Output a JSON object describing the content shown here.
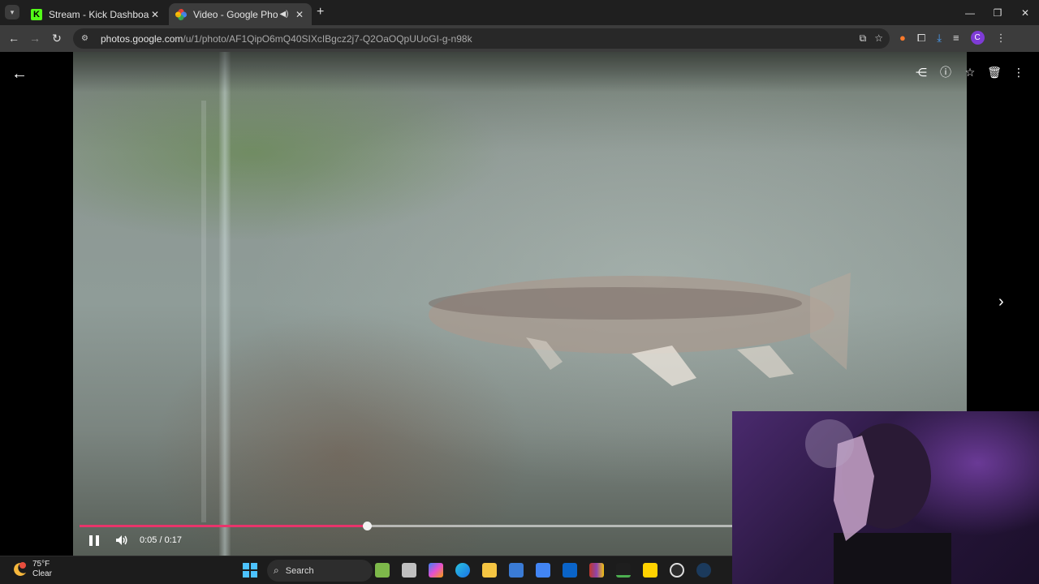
{
  "browser": {
    "tabs": [
      {
        "title": "Stream - Kick Dashboard",
        "icon": "kick-icon",
        "active": false
      },
      {
        "title": "Video - Google Photos",
        "icon": "google-photos-icon",
        "active": true,
        "audio": true
      }
    ],
    "kick_letter": "K",
    "url_host": "photos.google.com",
    "url_path": "/u/1/photo/AF1QipO6mQ40SIXcIBgcz2j7-Q2OaOQpUUoGI-g-n98k",
    "profile_initial": "C",
    "colors": {
      "accent_kick": "#53fc18",
      "profile": "#7e3bd6"
    }
  },
  "viewer": {
    "media_type": "video",
    "time_display": "0:05 / 0:17",
    "progress_fraction": 0.324,
    "seek_color": "#e8346b"
  },
  "taskbar": {
    "weather_temp": "75°F",
    "weather_desc": "Clear",
    "search_label": "Search",
    "apps": [
      "bamboo-app-icon",
      "task-view-icon",
      "copilot-icon",
      "edge-icon",
      "file-explorer-icon",
      "microsoft-store-icon",
      "docs-icon",
      "outlook-icon",
      "winrar-icon",
      "stocks-icon",
      "ex-app-icon",
      "obs-icon",
      "steam-icon"
    ]
  }
}
